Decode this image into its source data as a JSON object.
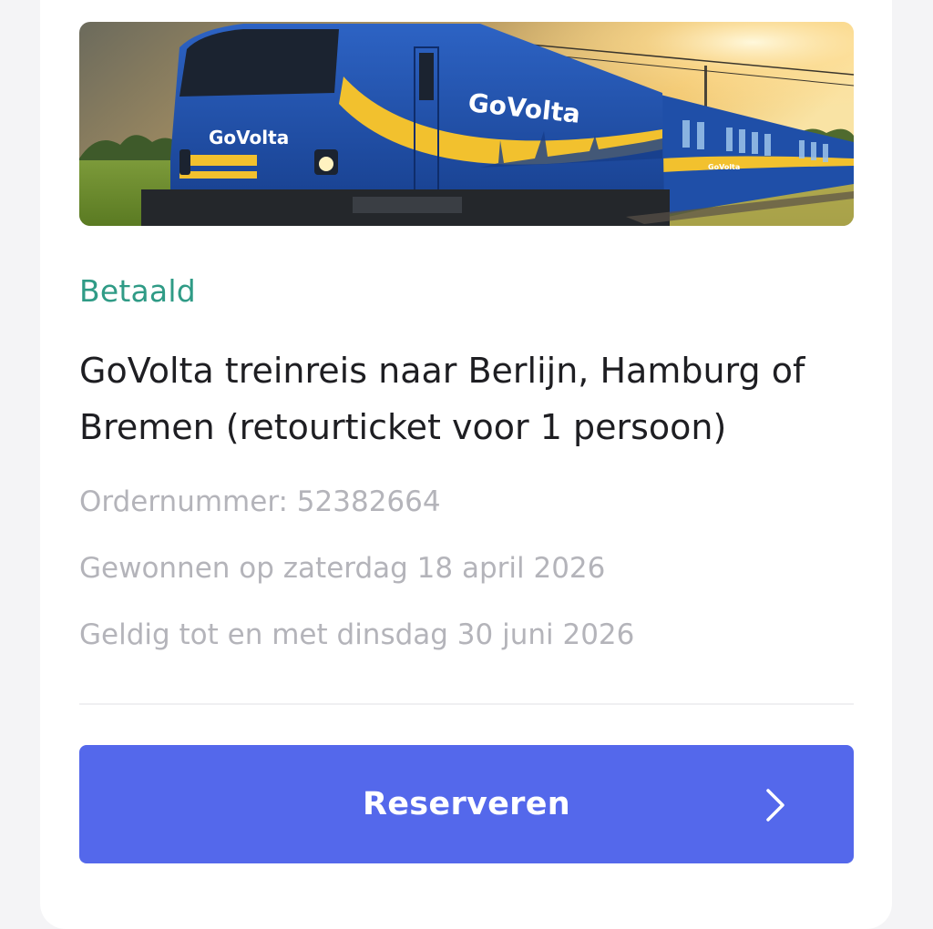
{
  "product": {
    "status": "Betaald",
    "title": "GoVolta treinreis naar Berlijn, Hamburg of Bremen (retourticket voor 1 persoon)",
    "order_number": "Ordernummer: 52382664",
    "won_on": "Gewonnen op zaterdag 18 april 2026",
    "valid_until": "Geldig tot en met dinsdag 30 juni 2026"
  },
  "image": {
    "brand_text_front": "GoVolta",
    "brand_text_side": "GoVolta",
    "brand_text_coach": "GoVolta"
  },
  "actions": {
    "reserve_label": "Reserveren",
    "reserve_icon": "chevron-right-icon"
  },
  "colors": {
    "status_green": "#2f9b86",
    "button_blue": "#5468eb",
    "train_blue": "#1f4fa8",
    "train_yellow": "#f2c12e"
  }
}
